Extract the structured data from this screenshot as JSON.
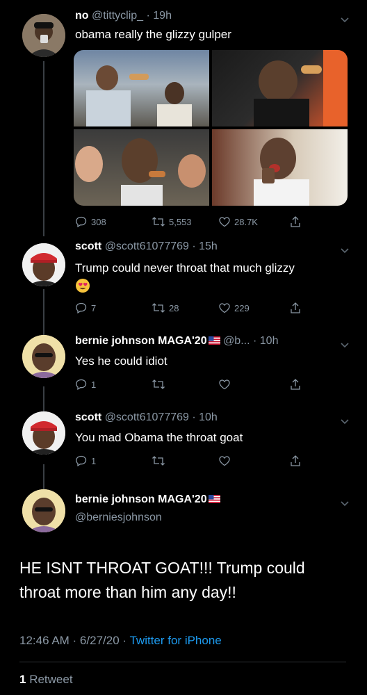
{
  "tweets": [
    {
      "name": "no",
      "handle": "@tittyclip_",
      "time": "· 19h",
      "text": "obama really the glizzy gulper",
      "replies": "308",
      "retweets": "5,553",
      "likes": "28.7K"
    },
    {
      "name": "scott",
      "handle": "@scott61077769",
      "time": "· 15h",
      "text": "Trump could never throat that much glizzy",
      "emoji": "heart-eyes-emoji",
      "replies": "7",
      "retweets": "28",
      "likes": "229"
    },
    {
      "name": "bernie johnson MAGA'20",
      "handle": "@b...",
      "time": "· 10h",
      "text": "Yes he could idiot",
      "replies": "1",
      "retweets": "",
      "likes": ""
    },
    {
      "name": "scott",
      "handle": "@scott61077769",
      "time": "· 10h",
      "text": "You mad Obama the throat goat",
      "replies": "1",
      "retweets": "",
      "likes": ""
    }
  ],
  "main_tweet": {
    "name": "bernie johnson MAGA'20",
    "handle": "@berniesjohnson",
    "text": "HE ISNT THROAT GOAT!!! Trump could throat more than him any day!!",
    "timestamp": "12:46 AM · 6/27/20 · ",
    "source": "Twitter for iPhone",
    "retweet_count": "1",
    "retweet_label": " Retweet"
  },
  "colors": {
    "background": "#000000",
    "muted": "#8b98a5",
    "link": "#1d9bf0",
    "divider": "#2f3336"
  }
}
